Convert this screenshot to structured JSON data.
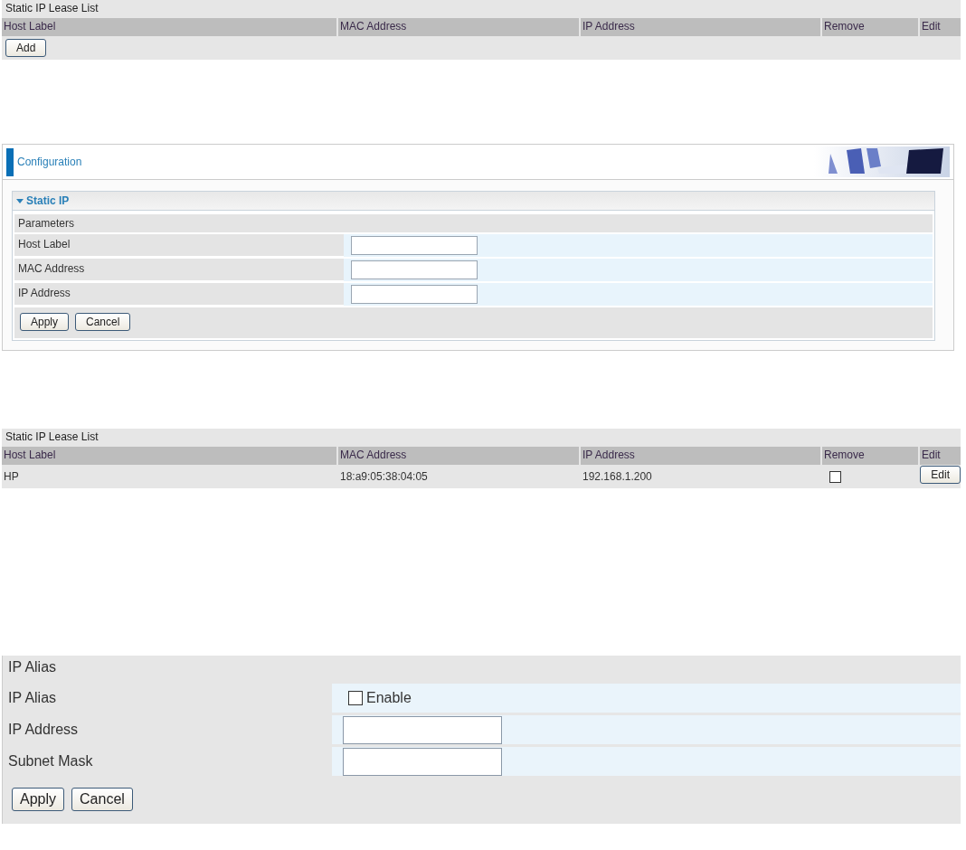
{
  "lease_list_empty": {
    "title": "Static IP Lease List",
    "columns": [
      "Host Label",
      "MAC Address",
      "IP Address",
      "Remove",
      "Edit"
    ],
    "buttons": [
      "Add"
    ]
  },
  "configuration": {
    "title": "Configuration",
    "section": {
      "title": "Static IP",
      "expanded": true,
      "header": "Parameters",
      "fields": [
        {
          "label": "Host Label"
        },
        {
          "label": "MAC Address"
        },
        {
          "label": "IP Address"
        }
      ],
      "buttons": [
        "Apply",
        "Cancel"
      ]
    }
  },
  "lease_list": {
    "title": "Static IP Lease List",
    "columns": [
      "Host Label",
      "MAC Address",
      "IP Address",
      "Remove",
      "Edit"
    ],
    "rows": [
      {
        "host_label": "HP",
        "mac_address": "18:a9:05:38:04:05",
        "ip_address": "192.168.1.200",
        "remove": false,
        "edit_button": "Edit"
      }
    ]
  },
  "ip_alias": {
    "title": "IP Alias",
    "rows": [
      {
        "kind": "checkbox",
        "label": "IP Alias",
        "option": "Enable",
        "checked": false
      },
      {
        "kind": "input",
        "label": "IP Address"
      },
      {
        "kind": "input",
        "label": "Subnet Mask"
      }
    ],
    "buttons": [
      "Apply",
      "Cancel"
    ]
  }
}
